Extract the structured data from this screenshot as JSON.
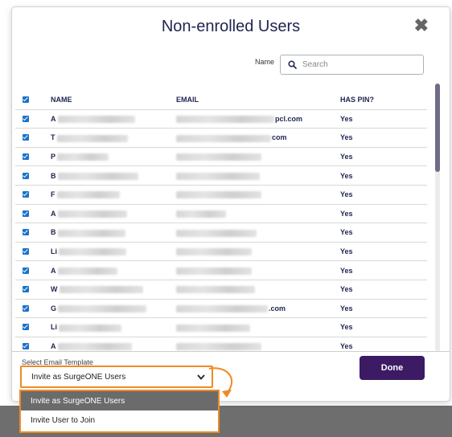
{
  "modal": {
    "title": "Non-enrolled Users",
    "close_glyph": "✖"
  },
  "search": {
    "label": "Name",
    "placeholder": "Search",
    "value": "",
    "icon": "search-icon"
  },
  "table": {
    "headers": {
      "name": "NAME",
      "email": "EMAIL",
      "has_pin": "HAS PIN?"
    },
    "rows": [
      {
        "checked": true,
        "name": "A",
        "email": "pcl.com",
        "has_pin": "Yes"
      },
      {
        "checked": true,
        "name": "T",
        "email": "com",
        "has_pin": "Yes"
      },
      {
        "checked": true,
        "name": "P",
        "email": "",
        "has_pin": "Yes"
      },
      {
        "checked": true,
        "name": "B",
        "email": "",
        "has_pin": "Yes"
      },
      {
        "checked": true,
        "name": "F",
        "email": "",
        "has_pin": "Yes"
      },
      {
        "checked": true,
        "name": "A",
        "email": "",
        "has_pin": "Yes"
      },
      {
        "checked": true,
        "name": "B",
        "email": "",
        "has_pin": "Yes"
      },
      {
        "checked": true,
        "name": "Li",
        "email": "",
        "has_pin": "Yes"
      },
      {
        "checked": true,
        "name": "A",
        "email": "",
        "has_pin": "Yes"
      },
      {
        "checked": true,
        "name": "W",
        "email": "",
        "has_pin": "Yes"
      },
      {
        "checked": true,
        "name": "G",
        "email": ".com",
        "has_pin": "Yes"
      },
      {
        "checked": true,
        "name": "Li",
        "email": "",
        "has_pin": "Yes"
      },
      {
        "checked": true,
        "name": "A",
        "email": "",
        "has_pin": "Yes"
      }
    ]
  },
  "footer": {
    "template_label": "Select Email Template",
    "selected_template": "Invite as SurgeONE Users",
    "done_label": "Done"
  },
  "dropdown": {
    "options": [
      "Invite as SurgeONE Users",
      "Invite User to Join"
    ],
    "selected_index": 0
  },
  "colors": {
    "title": "#1f2450",
    "done_button": "#3c1a64",
    "highlight": "#f08a24",
    "checkbox": "#1a73c9"
  }
}
